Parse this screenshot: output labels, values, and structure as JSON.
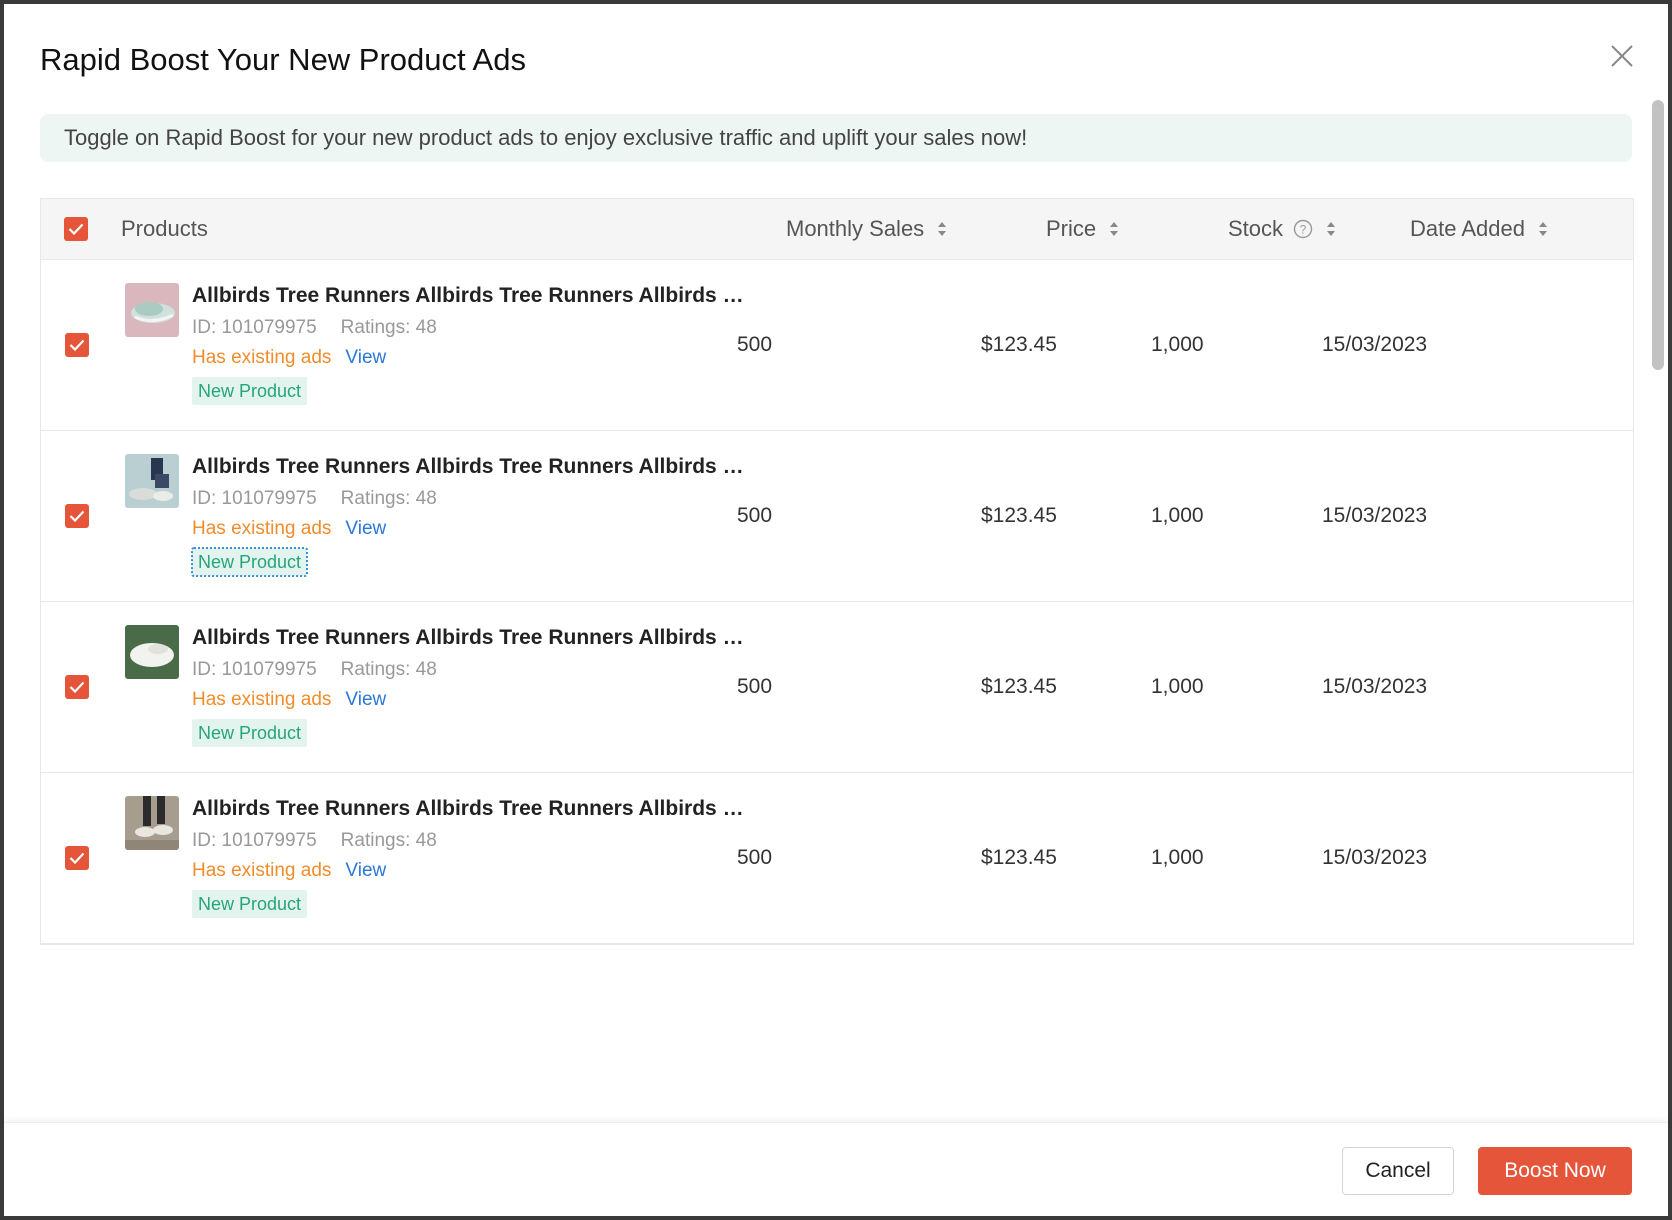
{
  "modal": {
    "title": "Rapid Boost Your New Product Ads",
    "banner": "Toggle on Rapid Boost for your new product ads to enjoy exclusive traffic and uplift your sales now!"
  },
  "table": {
    "headers": {
      "products": "Products",
      "monthly_sales": "Monthly Sales",
      "price": "Price",
      "stock": "Stock",
      "date_added": "Date Added"
    },
    "rows": [
      {
        "name": "Allbirds Tree Runners Allbirds Tree Runners Allbirds Tree Runners",
        "id": "ID: 101079975",
        "ratings": "Ratings: 48",
        "ads_status": "Has existing ads",
        "view_label": "View",
        "badge": "New Product",
        "monthly_sales": "500",
        "price": "$123.45",
        "stock": "1,000",
        "date_added": "15/03/2023"
      },
      {
        "name": "Allbirds Tree Runners Allbirds Tree Runners Allbirds Tree Runners",
        "id": "ID: 101079975",
        "ratings": "Ratings: 48",
        "ads_status": "Has existing ads",
        "view_label": "View",
        "badge": "New Product",
        "monthly_sales": "500",
        "price": "$123.45",
        "stock": "1,000",
        "date_added": "15/03/2023"
      },
      {
        "name": "Allbirds Tree Runners Allbirds Tree Runners Allbirds Tree Runners",
        "id": "ID: 101079975",
        "ratings": "Ratings: 48",
        "ads_status": "Has existing ads",
        "view_label": "View",
        "badge": "New Product",
        "monthly_sales": "500",
        "price": "$123.45",
        "stock": "1,000",
        "date_added": "15/03/2023"
      },
      {
        "name": "Allbirds Tree Runners Allbirds Tree Runners Allbirds Tree Runners",
        "id": "ID: 101079975",
        "ratings": "Ratings: 48",
        "ads_status": "Has existing ads",
        "view_label": "View",
        "badge": "New Product",
        "monthly_sales": "500",
        "price": "$123.45",
        "stock": "1,000",
        "date_added": "15/03/2023"
      }
    ]
  },
  "footer": {
    "cancel_label": "Cancel",
    "boost_label": "Boost Now"
  },
  "colors": {
    "accent": "#e4553a",
    "banner_bg": "#eef6f4",
    "badge_bg": "#e3f4ee",
    "badge_text": "#26a57c",
    "existing_ads": "#f08c2a",
    "link": "#2a78d6"
  },
  "icons": {
    "close": "close-icon",
    "checkbox": "checkbox-checked-icon",
    "sort": "sort-icon",
    "help": "help-icon"
  }
}
